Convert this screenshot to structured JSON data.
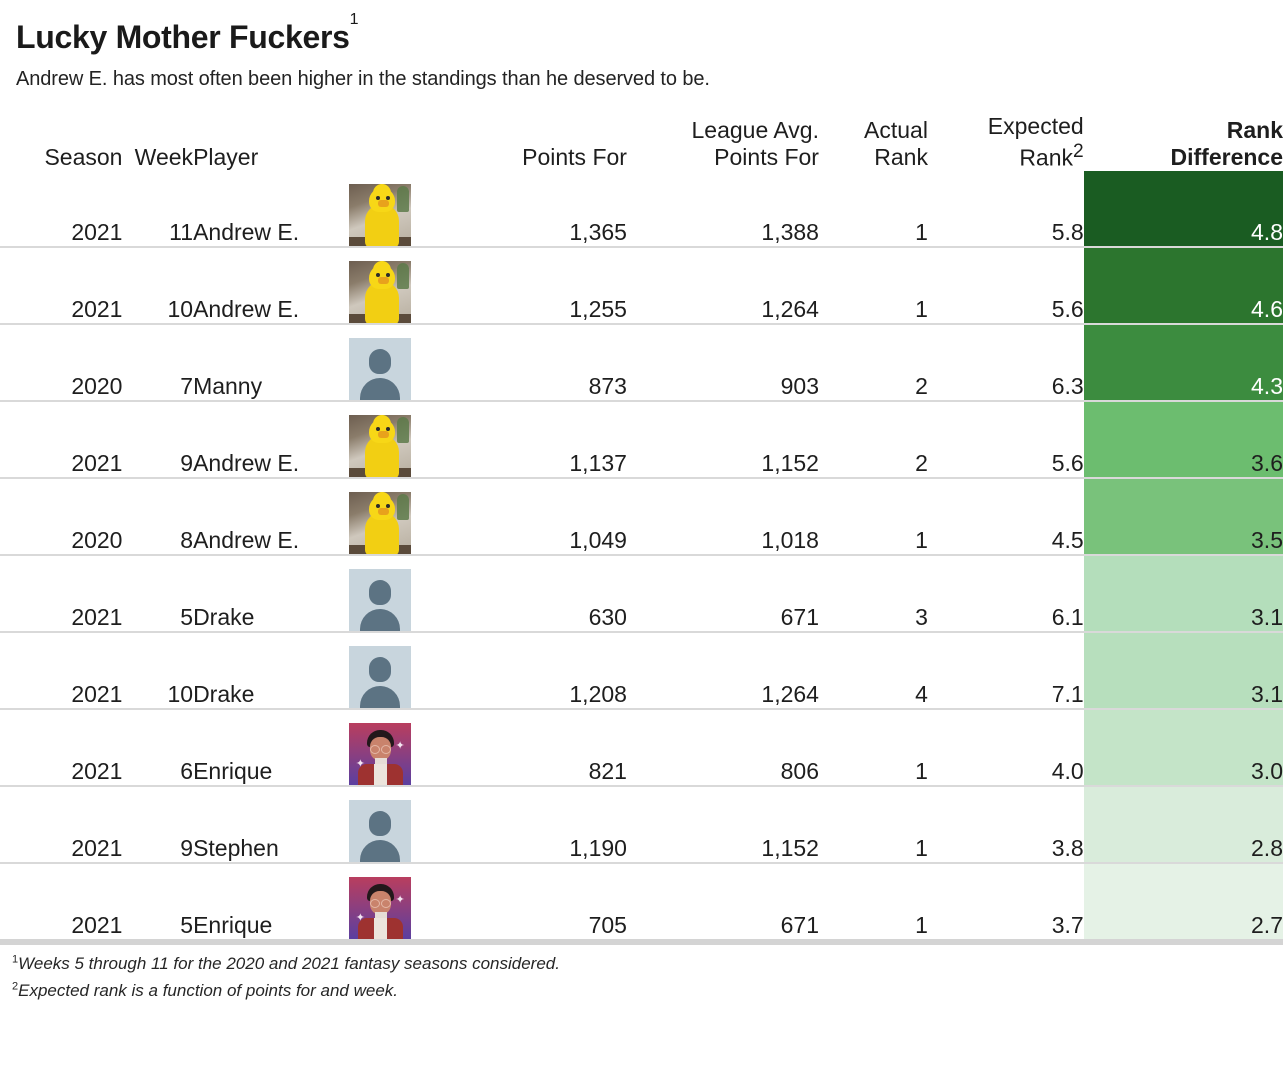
{
  "header": {
    "title": "Lucky Mother Fuckers",
    "title_footnote_marker": "1",
    "subtitle": "Andrew E. has most often been higher in the standings than he deserved to be."
  },
  "table": {
    "columns": [
      {
        "key": "season",
        "label": "Season"
      },
      {
        "key": "week",
        "label": "Week"
      },
      {
        "key": "player",
        "label": "Player"
      },
      {
        "key": "avatar",
        "label": ""
      },
      {
        "key": "points_for",
        "label": "Points For"
      },
      {
        "key": "league_avg_points_for",
        "label": "League Avg.\nPoints For"
      },
      {
        "key": "actual_rank",
        "label": "Actual\nRank"
      },
      {
        "key": "expected_rank",
        "label": "Expected\nRank",
        "footnote_marker": "2"
      },
      {
        "key": "rank_difference",
        "label": "Rank\nDifference"
      }
    ],
    "rows": [
      {
        "season": "2021",
        "week": "11",
        "player": "Andrew E.",
        "avatar": "bigbird-avatar",
        "points_for": "1,365",
        "league_avg_points_for": "1,388",
        "actual_rank": "1",
        "expected_rank": "5.8",
        "rank_difference": "4.8",
        "diff_bg": "#1a5c22",
        "diff_fg": "#ffffff"
      },
      {
        "season": "2021",
        "week": "10",
        "player": "Andrew E.",
        "avatar": "bigbird-avatar",
        "points_for": "1,255",
        "league_avg_points_for": "1,264",
        "actual_rank": "1",
        "expected_rank": "5.6",
        "rank_difference": "4.6",
        "diff_bg": "#2c752e",
        "diff_fg": "#ffffff"
      },
      {
        "season": "2020",
        "week": "7",
        "player": "Manny",
        "avatar": "default-avatar",
        "points_for": "873",
        "league_avg_points_for": "903",
        "actual_rank": "2",
        "expected_rank": "6.3",
        "rank_difference": "4.3",
        "diff_bg": "#3c8c3f",
        "diff_fg": "#ffffff"
      },
      {
        "season": "2021",
        "week": "9",
        "player": "Andrew E.",
        "avatar": "bigbird-avatar",
        "points_for": "1,137",
        "league_avg_points_for": "1,152",
        "actual_rank": "2",
        "expected_rank": "5.6",
        "rank_difference": "3.6",
        "diff_bg": "#6cbd6f",
        "diff_fg": "#1e1e1e"
      },
      {
        "season": "2020",
        "week": "8",
        "player": "Andrew E.",
        "avatar": "bigbird-avatar",
        "points_for": "1,049",
        "league_avg_points_for": "1,018",
        "actual_rank": "1",
        "expected_rank": "4.5",
        "rank_difference": "3.5",
        "diff_bg": "#79c27b",
        "diff_fg": "#1e1e1e"
      },
      {
        "season": "2021",
        "week": "5",
        "player": "Drake",
        "avatar": "default-avatar",
        "points_for": "630",
        "league_avg_points_for": "671",
        "actual_rank": "3",
        "expected_rank": "6.1",
        "rank_difference": "3.1",
        "diff_bg": "#b4debb",
        "diff_fg": "#1e1e1e"
      },
      {
        "season": "2021",
        "week": "10",
        "player": "Drake",
        "avatar": "default-avatar",
        "points_for": "1,208",
        "league_avg_points_for": "1,264",
        "actual_rank": "4",
        "expected_rank": "7.1",
        "rank_difference": "3.1",
        "diff_bg": "#b7dfbd",
        "diff_fg": "#1e1e1e"
      },
      {
        "season": "2021",
        "week": "6",
        "player": "Enrique",
        "avatar": "enrique-avatar",
        "points_for": "821",
        "league_avg_points_for": "806",
        "actual_rank": "1",
        "expected_rank": "4.0",
        "rank_difference": "3.0",
        "diff_bg": "#c4e4c8",
        "diff_fg": "#1e1e1e"
      },
      {
        "season": "2021",
        "week": "9",
        "player": "Stephen",
        "avatar": "default-avatar",
        "points_for": "1,190",
        "league_avg_points_for": "1,152",
        "actual_rank": "1",
        "expected_rank": "3.8",
        "rank_difference": "2.8",
        "diff_bg": "#d9ecdb",
        "diff_fg": "#1e1e1e"
      },
      {
        "season": "2021",
        "week": "5",
        "player": "Enrique",
        "avatar": "enrique-avatar",
        "points_for": "705",
        "league_avg_points_for": "671",
        "actual_rank": "1",
        "expected_rank": "3.7",
        "rank_difference": "2.7",
        "diff_bg": "#e5f2e6",
        "diff_fg": "#1e1e1e"
      }
    ]
  },
  "footnotes": [
    {
      "marker": "1",
      "text": "Weeks 5 through 11 for the 2020 and 2021 fantasy seasons considered."
    },
    {
      "marker": "2",
      "text": "Expected rank is a function of points for and week."
    }
  ]
}
